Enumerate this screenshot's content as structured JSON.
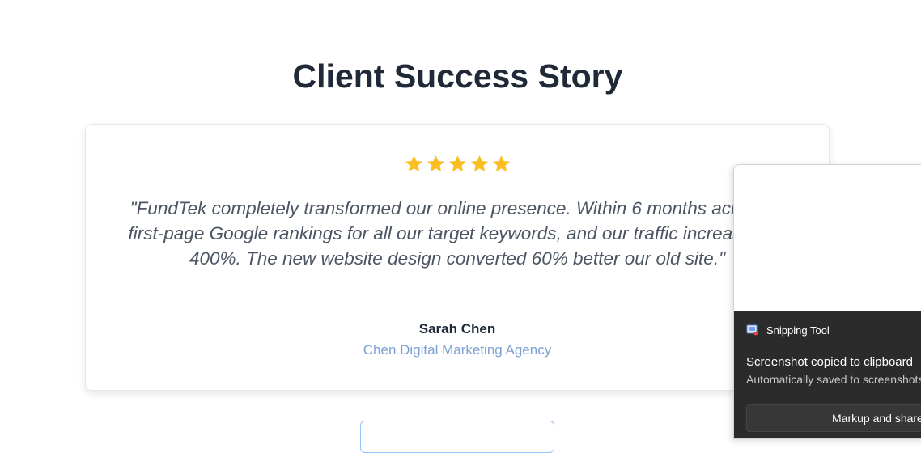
{
  "page": {
    "title": "Client Success Story"
  },
  "testimonial": {
    "rating": 5,
    "rating_max": 5,
    "star_color": "#fbbf24",
    "quote": "\"FundTek completely transformed our online presence. Within 6 months achieved first-page Google rankings for all our target keywords, and our traffic increased by 400%. The new website design converted 60% better our old site.\"",
    "author_name": "Sarah Chen",
    "author_company": "Chen Digital Marketing Agency"
  },
  "notification": {
    "app_name": "Snipping Tool",
    "icon": "snipping-tool-icon",
    "heading": "Screenshot copied to clipboard",
    "subtext": "Automatically saved to screenshots folder",
    "action_label": "Markup and share"
  },
  "colors": {
    "title": "#1f2937",
    "company": "#7da0d4",
    "toast_background": "#2b2b2b"
  }
}
